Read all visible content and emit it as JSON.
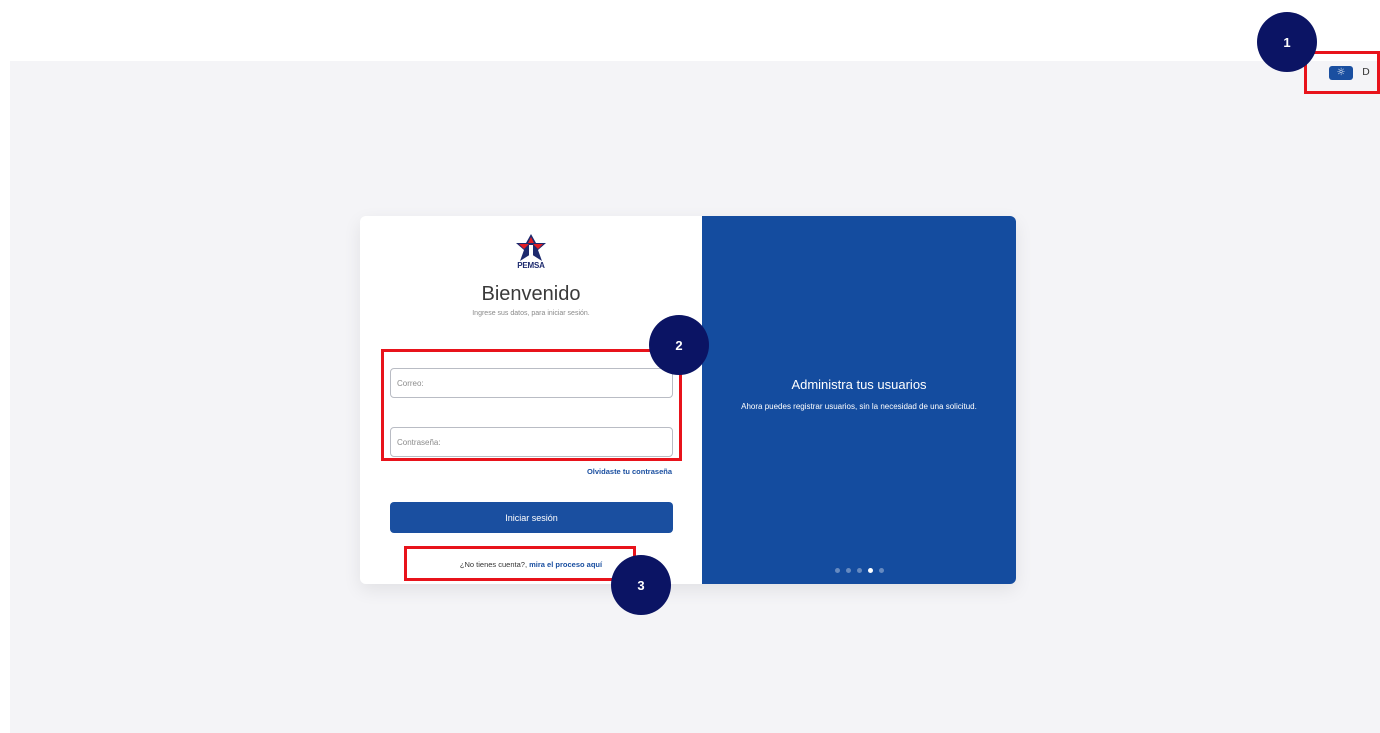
{
  "theme_toggle": {
    "light_icon": "sun-icon",
    "dark_icon": "moon-icon",
    "light_glyph": "☼",
    "dark_glyph": "D"
  },
  "brand": {
    "logo_text": "PEMSA"
  },
  "login": {
    "title": "Bienvenido",
    "subtitle": "Ingrese sus datos, para iniciar sesión.",
    "email_placeholder": "Correo:",
    "password_placeholder": "Contraseña:",
    "forgot_link": "Olvidaste tu contraseña",
    "submit_label": "Iniciar sesión",
    "signup_prompt": "¿No tienes cuenta?,",
    "signup_link": "mira el proceso aquí"
  },
  "carousel": {
    "title": "Administra tus usuarios",
    "text": "Ahora puedes registrar usuarios, sin la necesidad de una solicitud.",
    "slide_count": 5,
    "active_index": 3
  },
  "annotations": {
    "one": "1",
    "two": "2",
    "three": "3"
  },
  "colors": {
    "primary": "#1a4fa0",
    "panel": "#144c9f",
    "annotation_red": "#e8131b",
    "annotation_navy": "#0b1464"
  }
}
